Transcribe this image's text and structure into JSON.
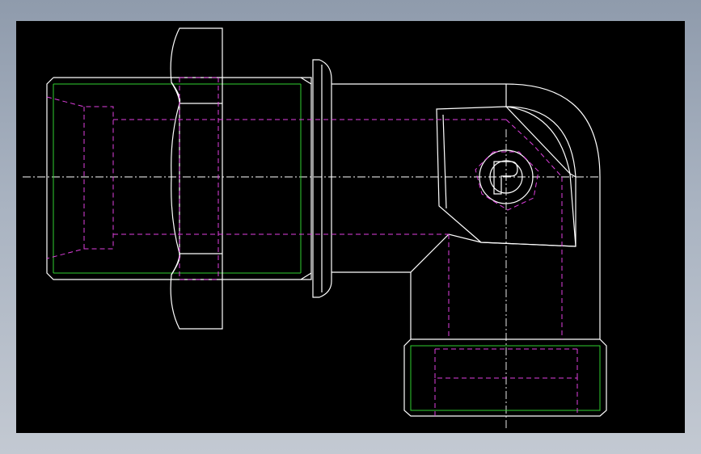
{
  "drawing": {
    "background": "#000000",
    "frame_gradient": [
      "#8f9bac",
      "#c3c9d2"
    ],
    "colors": {
      "outline": "#ffffff",
      "thread": "#2fd12f",
      "hidden": "#e040e0",
      "centerline": "#ffffff"
    },
    "view": "elbow-fitting-side-view",
    "parts": [
      "hex-nut",
      "male-thread-end",
      "collar",
      "elbow-body",
      "female-thread-outlet",
      "pin-circle"
    ]
  }
}
